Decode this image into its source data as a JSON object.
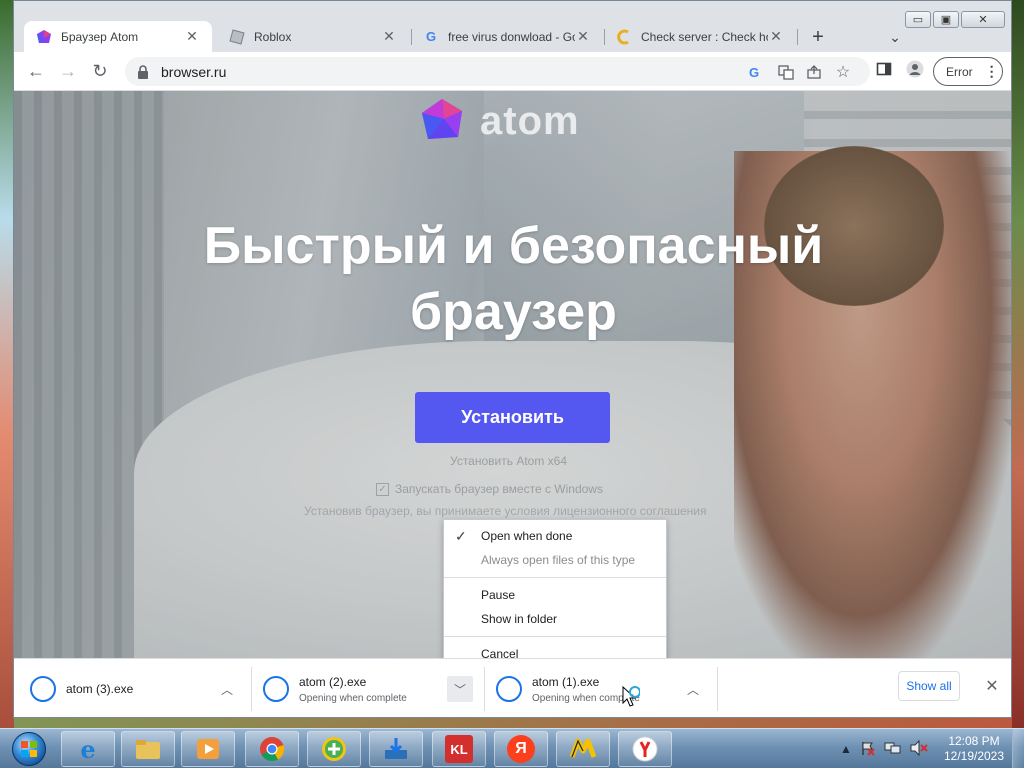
{
  "window": {
    "tabs": [
      {
        "title": "Браузер Atom",
        "active": true,
        "icon": "atom-favicon"
      },
      {
        "title": "Roblox",
        "active": false,
        "icon": "roblox-favicon"
      },
      {
        "title": "free virus donwload - Go",
        "active": false,
        "icon": "google-favicon"
      },
      {
        "title": "Check server : Check ho",
        "active": false,
        "icon": "check-host-favicon"
      }
    ],
    "new_tab_symbol": "+",
    "tab_list_symbol": "⌄",
    "controls": {
      "minimize": "▭",
      "maximize": "▣",
      "close": "✕"
    }
  },
  "toolbar": {
    "back": "←",
    "forward": "→",
    "reload": "↻",
    "url": "browser.ru",
    "profile_button_label": "Error"
  },
  "page": {
    "logo_text": "atom",
    "headline_line1": "Быстрый и безопасный",
    "headline_line2": "браузер",
    "install_button": "Установить",
    "install_sub": "Установить Atom x64",
    "autostart_label": "Запускать браузер вместе с Windows",
    "terms_text": "Установив браузер, вы принимаете условия лицензионного соглашения"
  },
  "context_menu": {
    "items": [
      {
        "label": "Open when done",
        "checked": true,
        "enabled": true
      },
      {
        "label": "Always open files of this type",
        "checked": false,
        "enabled": false
      },
      {
        "label": "Pause",
        "checked": false,
        "enabled": true
      },
      {
        "label": "Show in folder",
        "checked": false,
        "enabled": true
      },
      {
        "label": "Cancel",
        "checked": false,
        "enabled": true
      }
    ]
  },
  "downloads": {
    "items": [
      {
        "name": "atom (3).exe",
        "status": ""
      },
      {
        "name": "atom (2).exe",
        "status": "Opening when complete"
      },
      {
        "name": "atom (1).exe",
        "status": "Opening when complete"
      }
    ],
    "show_all": "Show all",
    "close": "✕"
  },
  "taskbar": {
    "apps": [
      "internet-explorer",
      "file-explorer",
      "media-player",
      "chrome",
      "plus-app",
      "downloader",
      "kl-app",
      "yandex-ya",
      "yandex-market",
      "yandex-browser"
    ],
    "kl_label": "KL",
    "ya_label": "Я",
    "clock_time": "12:08 PM",
    "clock_date": "12/19/2023"
  },
  "colors": {
    "install_button": "#5457f0",
    "download_ring": "#1a73e8",
    "link_blue": "#1a73e8"
  }
}
